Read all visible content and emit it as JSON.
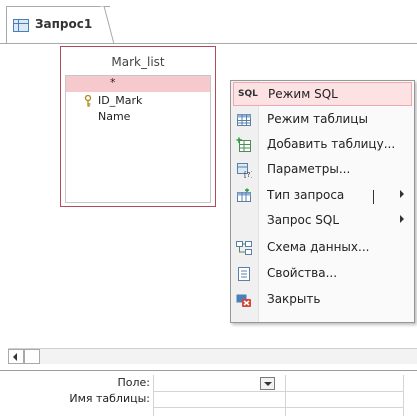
{
  "tab": {
    "title": "Запрос1"
  },
  "table_window": {
    "title": "Mark_list",
    "fields": [
      {
        "label": "*",
        "selected": true
      },
      {
        "label": "ID_Mark",
        "key": true
      },
      {
        "label": "Name"
      }
    ]
  },
  "context_menu": {
    "items": [
      {
        "label": "Режим SQL",
        "icon": "sql-icon",
        "icon_text": "SQL",
        "highlighted": true
      },
      {
        "label": "Режим таблицы",
        "icon": "datasheet-icon"
      },
      {
        "label": "Добавить таблицу...",
        "icon": "add-table-icon"
      },
      {
        "label": "Параметры...",
        "icon": "parameters-icon"
      },
      {
        "label": "Тип запроса",
        "icon": "query-type-icon",
        "submenu": true
      },
      {
        "label": "Запрос SQL",
        "submenu": true
      },
      {
        "label": "Схема данных...",
        "icon": "relationships-icon"
      },
      {
        "label": "Свойства...",
        "icon": "properties-icon"
      },
      {
        "label": "Закрыть",
        "icon": "close-icon"
      }
    ]
  },
  "grid": {
    "rows": [
      "Поле:",
      "Имя таблицы:"
    ]
  },
  "colors": {
    "accent_border": "#b04b5a",
    "selection": "#f6c9cd",
    "menu_hover": "#fde2e4"
  }
}
